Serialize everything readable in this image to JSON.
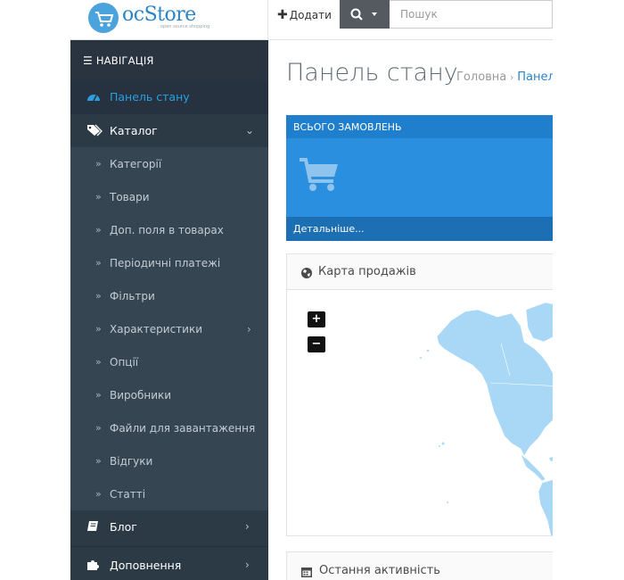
{
  "header": {
    "logo_text": "ocStore",
    "logo_tagline": "open source shopping",
    "add_label": "Додати",
    "search_placeholder": "Пошук"
  },
  "sidebar": {
    "nav_title": "НАВІГАЦІЯ",
    "dashboard": "Панель стану",
    "catalog": "Каталог",
    "catalog_items": [
      "Категорії",
      "Товари",
      "Доп. поля в товарах",
      "Періодичні платежі",
      "Фільтри",
      "Характеристики",
      "Опції",
      "Виробники",
      "Файли для завантаження",
      "Відгуки",
      "Статті"
    ],
    "blog": "Блог",
    "extensions": "Доповнення"
  },
  "content": {
    "page_title": "Панель стану",
    "breadcrumb_home": "Головна",
    "breadcrumb_current": "Панель стану",
    "orders_tile_title": "ВСЬОГО ЗАМОВЛЕНЬ",
    "orders_tile_link": "Детальніше...",
    "sales_map_title": "Карта продажів",
    "zoom_in": "+",
    "zoom_out": "−",
    "recent_activity_title": "Остання активність"
  },
  "colors": {
    "sidebar_bg": "#2c3a46",
    "submenu_bg": "#364552",
    "active_link": "#2a9fe0",
    "tile_bg": "#2a8fde",
    "map_land": "#a8d8f5"
  }
}
